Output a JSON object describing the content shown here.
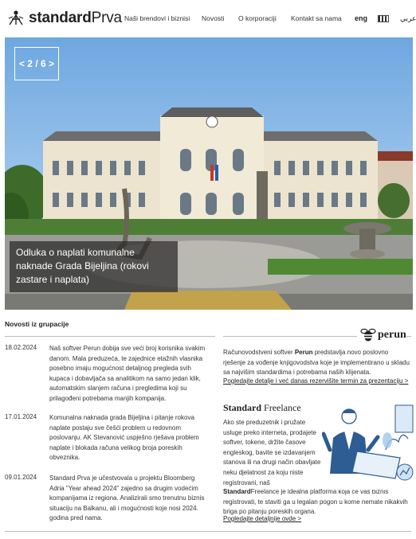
{
  "header": {
    "logo_text_bold": "standard",
    "logo_text_light": "Prva",
    "nav": [
      {
        "label": "Naši brendovi i biznisi"
      },
      {
        "label": "Novosti"
      },
      {
        "label": "O korporaciji"
      },
      {
        "label": "Kontakt sa nama"
      }
    ],
    "lang_eng": "eng",
    "lang_ar": "عربي"
  },
  "hero": {
    "counter": "< 2 / 6 >",
    "caption": "Odluka o naplati komunalne naknade Grada Bijeljina (rokovi zastare i naplata)"
  },
  "news": {
    "title": "Novosti iz grupacije",
    "items": [
      {
        "date": "18.02.2024",
        "text": "Naš softver Perun dobija sve veći broj korisnika svakim danom. Mala preduzeća, te zajednice etažnih vlasnika posebno imaju mogućnost detaljnog pregleda svih kupaca i dobavljača sa analitikom na samo jedan klik, automatskim slanjem računa i pregledima koji su prilagođeni potrebama manjih kompanija."
      },
      {
        "date": "17.01.2024",
        "text": "Komunalna naknada grada Bijeljina i pitanje rokova naplate postaju sve češći problem u redovnom poslovanju. AK Stevanović uspješno rješava problem naplate i blokada računa velikog broja poreskih obveznika."
      },
      {
        "date": "09.01.2024",
        "text": "Standard Prva je učestvovala u projektu Bloomberg Adria \"Year ahead 2024\" zajedno sa drugim vodećim kompanijama iz regiona. Analizirali smo trenutnu biznis situaciju na Balkanu, ali i mogućnosti koje nosi 2024. godina pred nama."
      }
    ]
  },
  "perun": {
    "logo": "perun",
    "text_before": "Računovodstveni softver ",
    "text_bold": "Perun",
    "text_after": " predstavlja novo poslovno rješenje za vođenje knjigovodstva koje je implementirano u skladu sa najvišim standardima i potrebama naših klijenata.",
    "link": "Pogledajte detalje i već danas rezervišite termin za prezentaciju >"
  },
  "freelance": {
    "title_bold": "Standard",
    "title_light": "Freelance",
    "text": "Ako ste preduzetnik i pružate usluge preko interneta, prodajete softver, tokene, držite časove engleskog, bavite se izdavanjem stanova ili na drugi način obavljate neku djelatnost za koju niste registrovani, naš",
    "text2_bold": "Standard",
    "text2": "Freelance je idealna platforma koja će vaš biznis registrovati, te staviti ga u legalan pogon u kome nemate nikakvih briga po pitanju poreskih organa.",
    "link": "Pogledajte detaljnije ovde >"
  }
}
